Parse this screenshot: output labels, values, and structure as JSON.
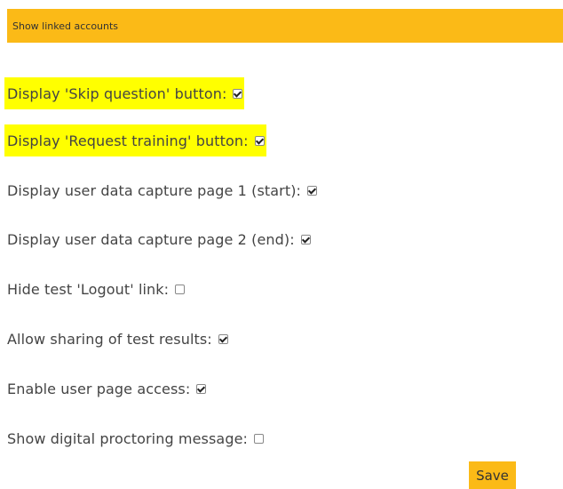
{
  "top_bar": {
    "label": "Show linked accounts"
  },
  "settings": [
    {
      "label": "Display 'Skip question' button:",
      "checked": true,
      "highlighted": true
    },
    {
      "label": "Display 'Request training' button:",
      "checked": true,
      "highlighted": true
    },
    {
      "label": "Display user data capture page 1 (start):",
      "checked": true,
      "highlighted": false
    },
    {
      "label": "Display user data capture page 2 (end):",
      "checked": true,
      "highlighted": false
    },
    {
      "label": "Hide test 'Logout' link:",
      "checked": false,
      "highlighted": false
    },
    {
      "label": "Allow sharing of test results:",
      "checked": true,
      "highlighted": false
    },
    {
      "label": "Enable user page access:",
      "checked": true,
      "highlighted": false
    },
    {
      "label": "Show digital proctoring message:",
      "checked": false,
      "highlighted": false
    }
  ],
  "save_label": "Save",
  "colors": {
    "accent": "#fbba17",
    "highlight": "#ffff00",
    "text": "#444444"
  }
}
